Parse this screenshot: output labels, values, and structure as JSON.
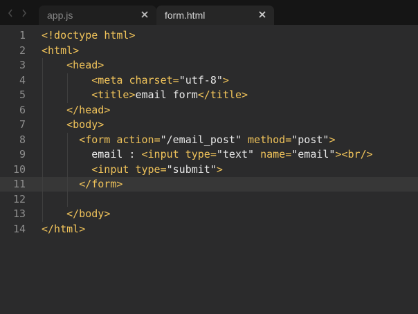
{
  "tabs": [
    {
      "label": "app.js",
      "active": false
    },
    {
      "label": "form.html",
      "active": true
    }
  ],
  "icons": {
    "back": "chevron-left-icon",
    "forward": "chevron-right-icon",
    "close": "close-icon"
  },
  "colors": {
    "tag": "#f0c35a",
    "text": "#ececec",
    "gutter": "#8e8e8e",
    "background": "#2b2b2c",
    "current_line": "#373737"
  },
  "editor": {
    "current_line": 11,
    "lines": [
      {
        "n": "1",
        "text": "<!doctype html>"
      },
      {
        "n": "2",
        "text": "<html>"
      },
      {
        "n": "3",
        "text": "    <head>"
      },
      {
        "n": "4",
        "text": "        <meta charset=\"utf-8\">"
      },
      {
        "n": "5",
        "text": "        <title>email form</title>"
      },
      {
        "n": "6",
        "text": "    </head>"
      },
      {
        "n": "7",
        "text": "    <body>"
      },
      {
        "n": "8",
        "text": "      <form action=\"/email_post\" method=\"post\">"
      },
      {
        "n": "9",
        "text": "        email : <input type=\"text\" name=\"email\"><br/>"
      },
      {
        "n": "10",
        "text": "        <input type=\"submit\">"
      },
      {
        "n": "11",
        "text": "      </form>"
      },
      {
        "n": "12",
        "text": ""
      },
      {
        "n": "13",
        "text": "    </body>"
      },
      {
        "n": "14",
        "text": "</html>"
      }
    ]
  }
}
